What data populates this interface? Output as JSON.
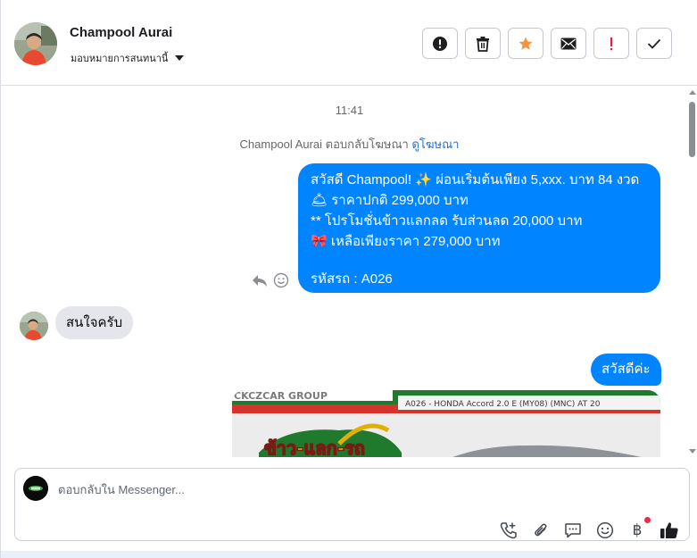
{
  "header": {
    "contact_name": "Champool Aurai",
    "assign_label": "มอบหมายการสนทนานี้",
    "actions": [
      {
        "name": "report-spam-button",
        "icon": "exclamation-circle-icon"
      },
      {
        "name": "delete-button",
        "icon": "trash-icon"
      },
      {
        "name": "star-button",
        "icon": "star-icon",
        "color": "#f7923a"
      },
      {
        "name": "mark-unread-button",
        "icon": "envelope-icon"
      },
      {
        "name": "follow-up-button",
        "icon": "exclamation-icon",
        "color": "#e41e3f"
      },
      {
        "name": "mark-done-button",
        "icon": "checkmark-icon"
      }
    ]
  },
  "conversation": {
    "timestamp": "11:41",
    "replied_prefix": "Champool Aurai ตอบกลับโฆษณา",
    "replied_link": "ดูโฆษณา",
    "promo_message": {
      "line1": "สวัสดี Champool! ✨  ผ่อนเริ่มต้นเพียง 5,xxx. บาท 84 งวด",
      "line2": "🛎 ราคาปกติ 299,000 บาท",
      "line3": "** โปรโมชั่นข้าวแลกลด รับส่วนลด 20,000 บาท",
      "line4": "🎀  เหลือเพียงราคา 279,000 บาท",
      "line5": "รหัสรถ : A026"
    },
    "incoming_message": "สนใจครับ",
    "greeting_message": "สวัสดีค่ะ",
    "image_caption": "A026 - HONDA Accord 2.0 E (MY08) (MNC) AT 20",
    "image_headline": "ข้าว-แลก-รถ",
    "image_brand": "CKCZCAR GROUP"
  },
  "composer": {
    "placeholder": "ตอบกลับใน Messenger...",
    "tools": [
      "add-call-icon",
      "paperclip-icon",
      "saved-reply-icon",
      "emoji-icon",
      "baht-payment-icon",
      "thumbs-up-icon"
    ],
    "baht_symbol": "฿"
  },
  "colors": {
    "brand_blue": "#0084ff",
    "link_blue": "#216fdb",
    "incoming_bubble": "#e4e6eb",
    "notification_red": "#f02849"
  }
}
